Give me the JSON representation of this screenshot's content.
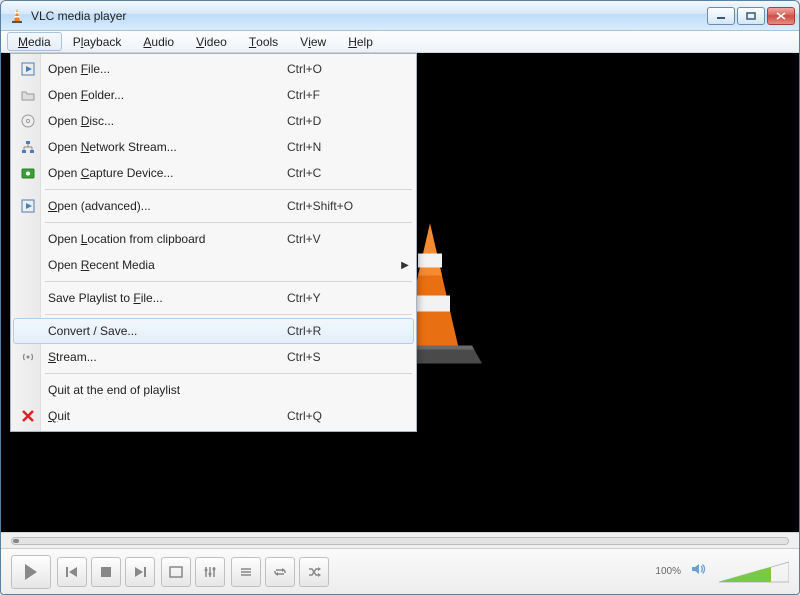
{
  "title": "VLC media player",
  "menubar": [
    {
      "label": "Media",
      "mkey": "M",
      "open": true
    },
    {
      "label": "Playback",
      "mkey": "l"
    },
    {
      "label": "Audio",
      "mkey": "A"
    },
    {
      "label": "Video",
      "mkey": "V"
    },
    {
      "label": "Tools",
      "mkey": "T"
    },
    {
      "label": "View",
      "mkey": "i"
    },
    {
      "label": "Help",
      "mkey": "H"
    }
  ],
  "media_menu": [
    {
      "icon": "play-file-icon",
      "label": "Open File...",
      "mkey": "F",
      "accel": "Ctrl+O"
    },
    {
      "icon": "folder-icon",
      "label": "Open Folder...",
      "mkey": "F",
      "accel": "Ctrl+F"
    },
    {
      "icon": "disc-icon",
      "label": "Open Disc...",
      "mkey": "D",
      "accel": "Ctrl+D"
    },
    {
      "icon": "network-icon",
      "label": "Open Network Stream...",
      "mkey": "N",
      "accel": "Ctrl+N"
    },
    {
      "icon": "capture-icon",
      "label": "Open Capture Device...",
      "mkey": "C",
      "accel": "Ctrl+C"
    },
    {
      "sep": true
    },
    {
      "icon": "play-file-icon",
      "label": "Open (advanced)...",
      "mkey": "O",
      "accel": "Ctrl+Shift+O"
    },
    {
      "sep": true
    },
    {
      "label": "Open Location from clipboard",
      "mkey": "L",
      "accel": "Ctrl+V"
    },
    {
      "label": "Open Recent Media",
      "mkey": "R",
      "submenu": true
    },
    {
      "sep": true
    },
    {
      "label": "Save Playlist to File...",
      "mkey": "F",
      "accel": "Ctrl+Y"
    },
    {
      "sep": true
    },
    {
      "label": "Convert / Save...",
      "mkey": "R",
      "accel": "Ctrl+R",
      "hover": true
    },
    {
      "icon": "stream-icon",
      "label": "Stream...",
      "mkey": "S",
      "accel": "Ctrl+S"
    },
    {
      "sep": true
    },
    {
      "label": "Quit at the end of playlist"
    },
    {
      "icon": "quit-icon",
      "label": "Quit",
      "mkey": "Q",
      "accel": "Ctrl+Q"
    }
  ],
  "volume_label": "100%"
}
